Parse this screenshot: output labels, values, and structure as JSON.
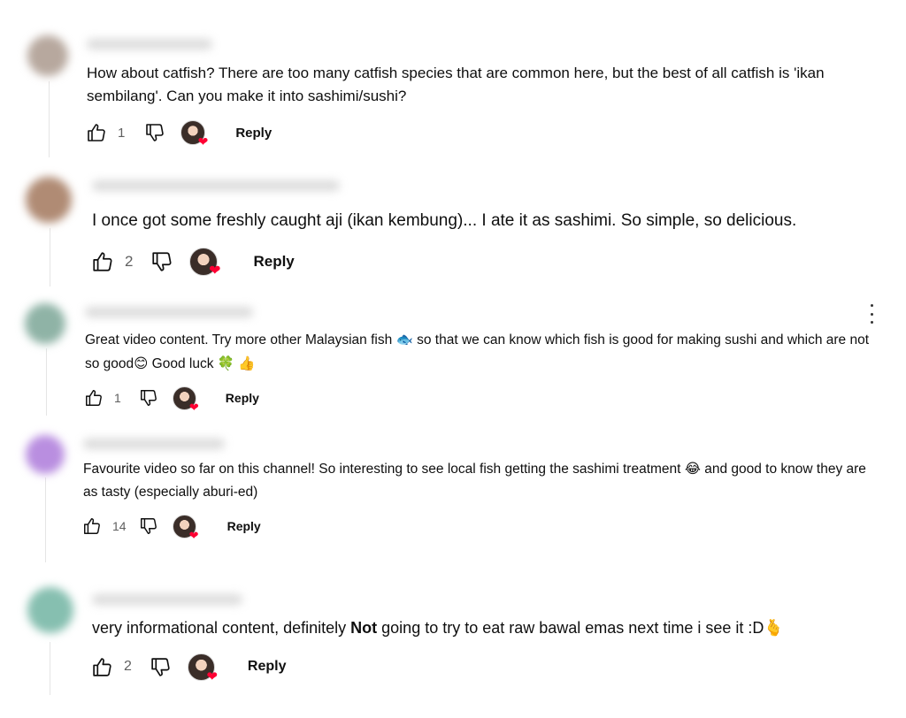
{
  "comments": [
    {
      "text": "How about catfish? There are too many catfish species that are common here, but the best of all catfish is 'ikan sembilang'. Can you make it into sashimi/sushi?",
      "likes": "1",
      "reply_label": "Reply",
      "avatar_color": "#b7a89e"
    },
    {
      "text": "I once got some freshly caught aji (ikan kembung)... I ate it as sashimi. So simple, so delicious.",
      "likes": "2",
      "reply_label": "Reply",
      "avatar_color": "#b08b74"
    },
    {
      "text_a": "Great video content. Try more other Malaysian fish ",
      "text_b": " so that we can know which fish is good for making sushi and which are not so good",
      "text_c": " Good luck ",
      "emoji_fish": "🐟",
      "emoji_smile": "😊",
      "emoji_clover": "🍀",
      "emoji_thumb": "👍",
      "likes": "1",
      "reply_label": "Reply",
      "avatar_color": "#8fb3a6"
    },
    {
      "text_a": "Favourite video so far on this channel! So interesting to see local fish getting the sashimi treatment ",
      "text_b": " and good to know they are as tasty (especially aburi-ed)",
      "emoji_laugh": "😂",
      "likes": "14",
      "reply_label": "Reply",
      "avatar_color": "#b98ee0"
    },
    {
      "text_a": "very informational content, definitely ",
      "text_bold": "Not",
      "text_b": " going to try to eat raw bawal emas next time i see it :D",
      "emoji_end": "🫰",
      "likes": "2",
      "reply_label": "Reply",
      "avatar_color": "#86bfb0"
    }
  ],
  "icons": {
    "like": "thumbs-up-icon",
    "dislike": "thumbs-down-icon",
    "more": "vertical-dots-icon",
    "creator_heart": "creator-heart-icon"
  },
  "colors": {
    "heart": "#ff0033",
    "secondary_text": "#606060",
    "thread_line": "#e5e5e5"
  }
}
